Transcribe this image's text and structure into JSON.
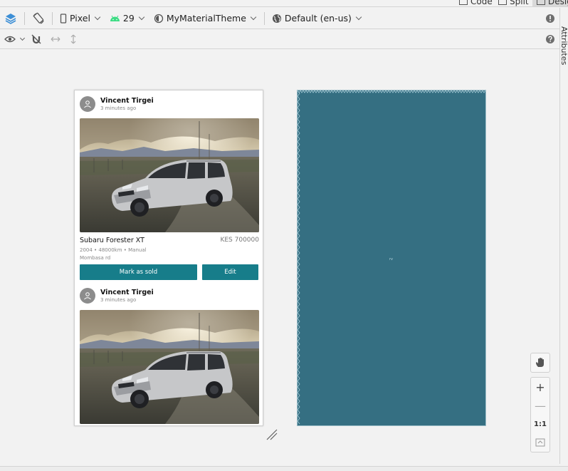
{
  "editor_tabs": {
    "code": "Code",
    "split": "Split",
    "design": "Design"
  },
  "toolbar": {
    "device": "Pixel",
    "api_level": "29",
    "theme": "MyMaterialTheme",
    "locale": "Default (en-us)"
  },
  "side_panel": {
    "attributes": "Attributes"
  },
  "posts": [
    {
      "author": "Vincent Tirgei",
      "time": "3 minutes ago",
      "title": "Subaru Forester XT",
      "price": "KES 700000",
      "details": "2004 • 48000km • Manual",
      "location": "Mombasa rd",
      "mark_sold_label": "Mark as sold",
      "edit_label": "Edit"
    },
    {
      "author": "Vincent Tirgei",
      "time": "3 minutes ago"
    }
  ],
  "blueprint": {
    "label": "rv"
  },
  "zoom": {
    "fit_label": "1:1",
    "zoom_in": "+",
    "zoom_out": "—"
  },
  "colors": {
    "accent": "#177d8a",
    "blueprint": "#356f82",
    "icon_blue": "#3d8fd6",
    "icon_green": "#3ddc84"
  }
}
